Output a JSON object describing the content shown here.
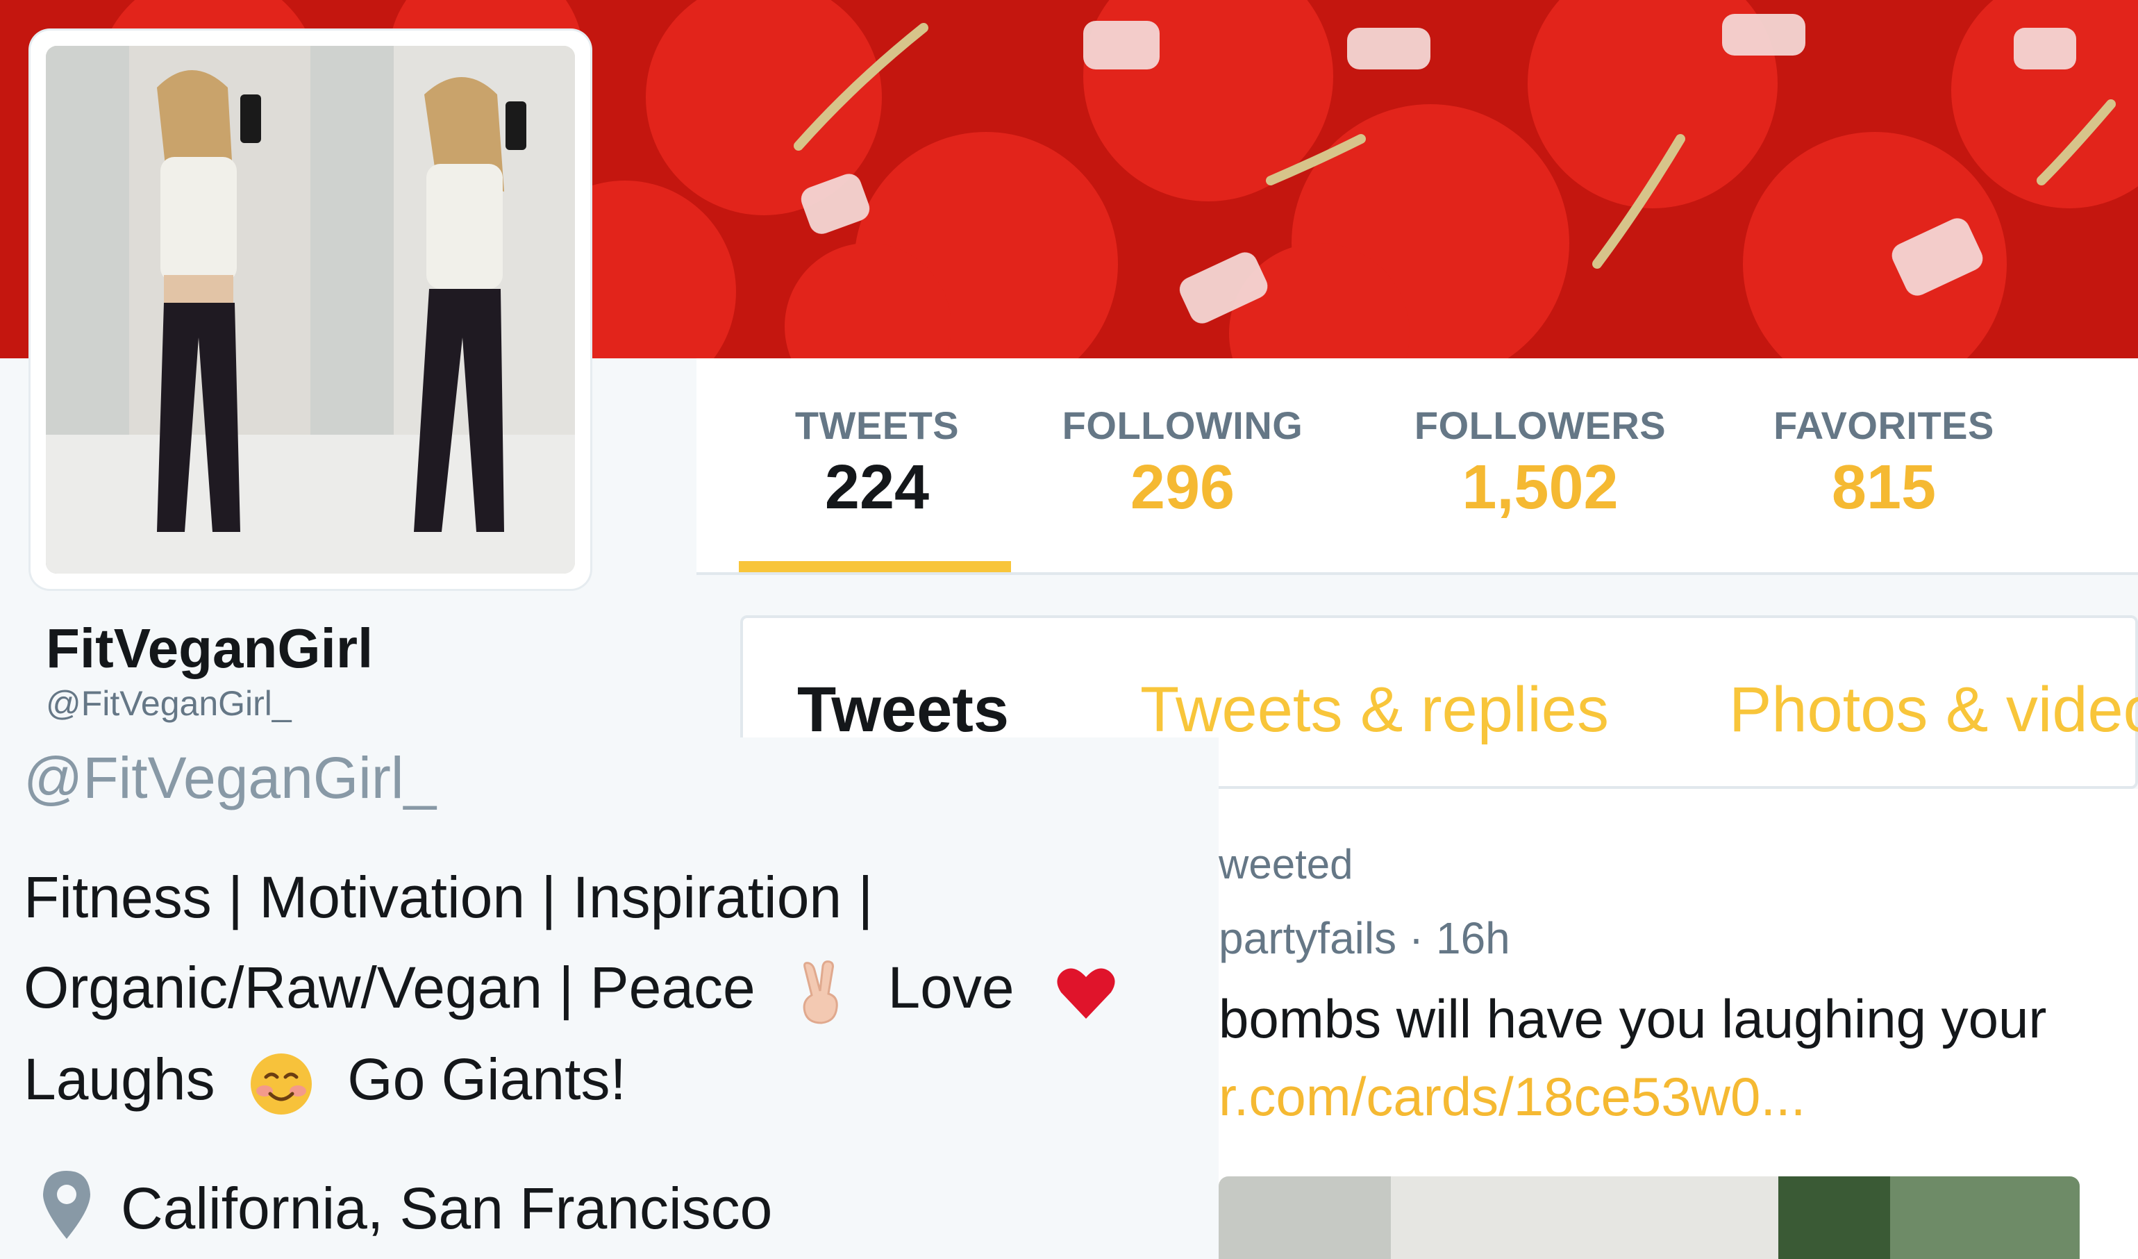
{
  "profile": {
    "display_name": "FitVeganGirl",
    "handle_small": "@FitVeganGirl_",
    "handle": "@FitVeganGirl_",
    "bio": {
      "line1": "Fitness | Motivation | Inspiration |",
      "line2_a": "Organic/Raw/Vegan | Peace",
      "line2_b": "Love",
      "line3_a": "Laughs",
      "line3_b": "Go Giants!"
    },
    "location": "California, San Francisco"
  },
  "stats": [
    {
      "label": "TWEETS",
      "value": "224"
    },
    {
      "label": "FOLLOWING",
      "value": "296"
    },
    {
      "label": "FOLLOWERS",
      "value": "1,502"
    },
    {
      "label": "FAVORITES",
      "value": "815"
    }
  ],
  "tabs": [
    {
      "label": "Tweets"
    },
    {
      "label": "Tweets & replies"
    },
    {
      "label": "Photos & video"
    }
  ],
  "tweet": {
    "retweet_label": "weeted",
    "meta": "partyfails · 16h",
    "text": "bombs will have you laughing your",
    "link": "r.com/cards/18ce53w0..."
  },
  "icons": {
    "location": "map-pin-icon",
    "peace": "victory-hand-emoji",
    "love": "heart-emoji",
    "smile": "smiling-face-emoji"
  },
  "colors": {
    "accent": "#f5b932",
    "text": "#14171a",
    "muted": "#657786"
  }
}
